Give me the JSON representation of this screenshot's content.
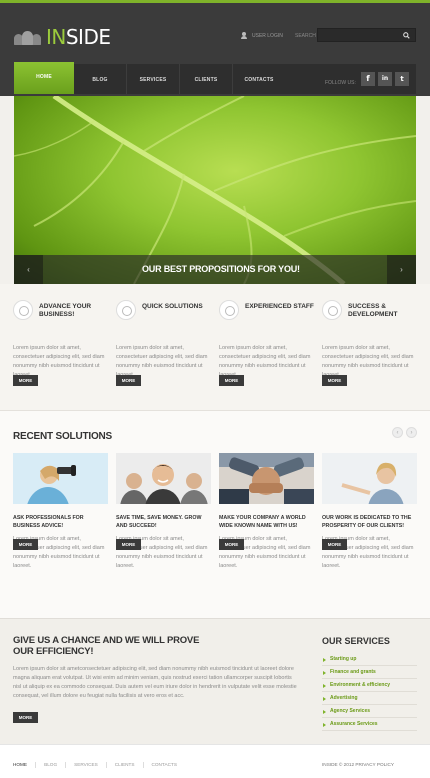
{
  "header": {
    "logo_text": "INSIDE",
    "user_login": "USER LOGIN",
    "search_label": "SEARCH",
    "search_value": ""
  },
  "nav": {
    "items": [
      "HOME",
      "BLOG",
      "SERVICES",
      "CLIENTS",
      "CONTACTS"
    ],
    "follow_label": "FOLLOW US:",
    "social": [
      "f",
      "in",
      "t"
    ]
  },
  "hero": {
    "caption": "OUR BEST PROPOSITIONS FOR YOU!",
    "prev": "‹",
    "next": "›"
  },
  "features": [
    {
      "title": "ADVANCE YOUR BUSINESS!",
      "text": "Lorem ipsum dolor sit amet, consectetuer adipiscing elit, sed diam nonummy nibh euismod tincidunt ut laoreet.",
      "more": "MORE"
    },
    {
      "title": "QUICK SOLUTIONS",
      "text": "Lorem ipsum dolor sit amet, consectetuer adipiscing elit, sed diam nonummy nibh euismod tincidunt ut laoreet.",
      "more": "MORE"
    },
    {
      "title": "EXPERIENCED STAFF",
      "text": "Lorem ipsum dolor sit amet, consectetuer adipiscing elit, sed diam nonummy nibh euismod tincidunt ut laoreet.",
      "more": "MORE"
    },
    {
      "title": "SUCCESS & DEVELOPMENT",
      "text": "Lorem ipsum dolor sit amet, consectetuer adipiscing elit, sed diam nonummy nibh euismod tincidunt ut laoreet.",
      "more": "MORE"
    }
  ],
  "recent": {
    "title": "RECENT SOLUTIONS",
    "prev": "‹",
    "next": "›",
    "items": [
      {
        "title": "ASK PROFESSIONALS FOR BUSINESS ADVICE!",
        "text": "Lorem ipsum dolor sit amet, consectetuer adipiscing elit, sed diam nonummy nibh euismod tincidunt ut laoreet.",
        "more": "MORE"
      },
      {
        "title": "SAVE TIME, SAVE MONEY. GROW AND SUCCEED!",
        "text": "Lorem ipsum dolor sit amet, consectetuer adipiscing elit, sed diam nonummy nibh euismod tincidunt ut laoreet.",
        "more": "MORE"
      },
      {
        "title": "MAKE YOUR COMPANY A WORLD WIDE KNOWN NAME WITH US!",
        "text": "Lorem ipsum dolor sit amet, consectetuer adipiscing elit, sed diam nonummy nibh euismod tincidunt ut laoreet.",
        "more": "MORE"
      },
      {
        "title": "OUR WORK IS DEDICATED TO THE PROSPERITY OF OUR CLIENTS!",
        "text": "Lorem ipsum dolor sit amet, consectetuer adipiscing elit, sed diam nonummy nibh euismod tincidunt ut laoreet.",
        "more": "MORE"
      }
    ]
  },
  "chance": {
    "title": "GIVE US A CHANCE AND WE WILL PROVE OUR EFFICIENCY!",
    "text": "Lorem ipsum dolor sit ametconsectetuer adipiscing elit, sed diam nonummy nibh euismod tincidunt ut laoreet dolore magna aliquam erat volutpat. Ut wisi enim ad minim veniam, quis nostrud exerci tation ullamcorper suscipit lobortis nisl ut aliquip ex ea commodo consequat. Duis autem vel eum iriure dolor in hendrerit in vulputate velit esse molestie consequat, vel illum dolore eu feugiat nulla facilisis at vero eros et acc.",
    "more": "MORE"
  },
  "services": {
    "title": "OUR SERVICES",
    "items": [
      "Starting up",
      "Finance and grants",
      "Environment & efficiency",
      "Advertising",
      "Agency Services",
      "Assurance Services"
    ]
  },
  "footer": {
    "links": [
      "HOME",
      "BLOG",
      "SERVICES",
      "CLIENTS",
      "CONTACTS"
    ],
    "copyright": "INSIDE © 2012 PRIVACY POLICY"
  }
}
